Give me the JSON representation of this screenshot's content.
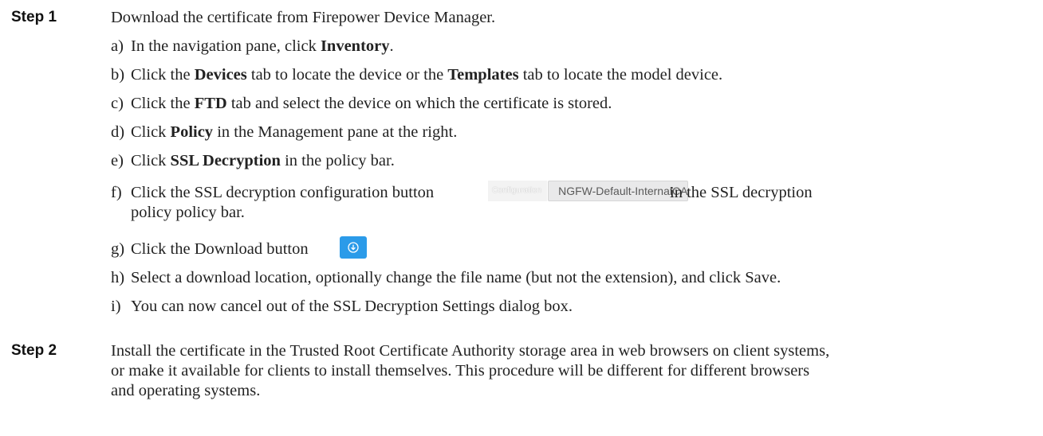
{
  "step1": {
    "label": "Step 1",
    "title": "Download the certificate from Firepower Device Manager.",
    "items": [
      {
        "letter": "a)",
        "pre": "In the navigation pane, click ",
        "b1": "Inventory",
        "post": "."
      },
      {
        "letter": "b)",
        "pre": "Click the ",
        "b1": "Devices",
        "mid": " tab to locate the device or the ",
        "b2": "Templates",
        "post": " tab to locate the model device."
      },
      {
        "letter": "c)",
        "pre": "Click the ",
        "b1": "FTD",
        "post": " tab and select the device on which the certificate is stored."
      },
      {
        "letter": "d)",
        "pre": "Click ",
        "b1": "Policy",
        "post": " in the Management pane at the right."
      },
      {
        "letter": "e)",
        "pre": "Click ",
        "b1": "SSL Decryption",
        "post": " in the policy bar."
      },
      {
        "letter": "f)",
        "pre": "Click the SSL decryption configuration button",
        "post": "in the SSL decryption",
        "cont": "policy policy bar.",
        "button_left": "Configuration",
        "button_right": "NGFW-Default-InternalCA"
      },
      {
        "letter": "g)",
        "pre": "Click the Download button",
        "icon": "download-icon"
      },
      {
        "letter": "h)",
        "pre": "Select a download location, optionally change the file name (but not the extension), and click Save."
      },
      {
        "letter": "i)",
        "pre": "You can now cancel out of the SSL Decryption Settings dialog box."
      }
    ]
  },
  "step2": {
    "label": "Step 2",
    "lines": [
      "Install the certificate in the Trusted Root Certificate Authority storage area in web browsers on client systems,",
      "or make it available for clients to install themselves. This procedure will be different for different browsers",
      "and operating systems."
    ]
  },
  "colors": {
    "download_button": "#2b9be9",
    "text": "#222222"
  }
}
